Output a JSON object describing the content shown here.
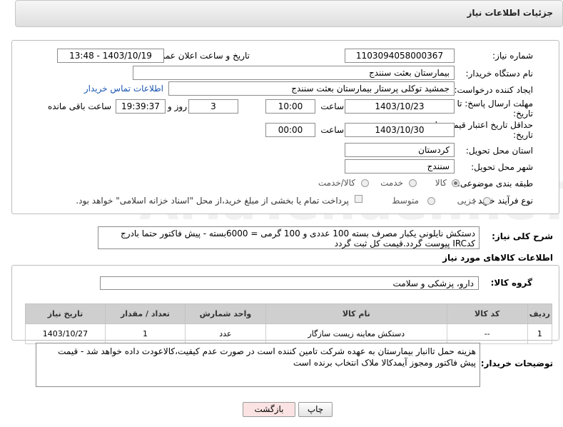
{
  "header": {
    "title": "جزئیات اطلاعات نیاز"
  },
  "form": {
    "need_number_label": "شماره نیاز:",
    "need_number": "1103094058000367",
    "announce_label": "تاریخ و ساعت اعلان عمومی:",
    "announce_value": "1403/10/19 - 13:48",
    "buyer_org_label": "نام دستگاه خریدار:",
    "buyer_org": "بیمارستان بعثت سنندج",
    "requester_label": "ایجاد کننده درخواست:",
    "requester": "جمشید  توکلی پرستار بیمارستان بعثت سنندج",
    "contact_link": "اطلاعات تماس خریدار",
    "reply_deadline_label_1": "مهلت ارسال پاسخ: تا",
    "reply_deadline_label_2": "تاریخ:",
    "reply_date": "1403/10/23",
    "time_label": "ساعت",
    "reply_time": "10:00",
    "days": "3",
    "days_label": "روز و",
    "remaining_time": "19:39:37",
    "remaining_label": "ساعت باقی مانده",
    "price_validity_label_1": "حداقل تاریخ اعتبار قیمت: تا",
    "price_validity_label_2": "تاریخ:",
    "price_date": "1403/10/30",
    "price_time": "00:00",
    "province_label": "استان محل تحویل:",
    "province": "کردستان",
    "city_label": "شهر محل تحویل:",
    "city": "سنندج",
    "category_label": "طبقه بندی موضوعی:",
    "category_options": [
      "کالا",
      "خدمت",
      "کالا/خدمت"
    ],
    "process_label": "نوع فرآیند خرید :",
    "process_options": [
      "جزیی",
      "متوسط"
    ],
    "payment_note": "پرداخت تمام یا بخشی از مبلغ خرید،از محل \"اسناد خزانه اسلامی\" خواهد بود."
  },
  "summary": {
    "label": "شرح کلی نیاز:",
    "text": "دستکش نایلونی یکبار مصرف بسته 100 عددی و 100 گرمی = 6000بسته - پیش فاکتور حتما بادرج کدIRC پیوست گردد.قیمت کل ثبت گردد"
  },
  "goods": {
    "section_title": "اطلاعات کالاهای مورد نیاز",
    "group_label": "گروه کالا:",
    "group_value": "دارو، پزشکی و سلامت",
    "columns": [
      "ردیف",
      "کد کالا",
      "نام کالا",
      "واحد شمارش",
      "تعداد / مقدار",
      "تاریخ نیاز"
    ],
    "rows": [
      [
        "1",
        "--",
        "دستکش معاینه زیست سازگار",
        "عدد",
        "1",
        "1403/10/27"
      ]
    ]
  },
  "buyer_notes": {
    "label": "توضیحات خریدار:",
    "text": "هزینه حمل تاانبار بیمارستان به عهده شرکت تامین کننده است در صورت عدم کیفیت،کالاعودت داده خواهد شد - قیمت پیش فاکتور ومجوز آیمدکالا ملاک انتخاب برنده است"
  },
  "buttons": {
    "print": "چاپ",
    "back": "بازگشت"
  },
  "watermark": {
    "text": "AriaTender.neT"
  },
  "colors": {
    "link": "#1a55b0",
    "back_button_bg": "#fbe3e3",
    "table_header": "#cfcfcf"
  }
}
